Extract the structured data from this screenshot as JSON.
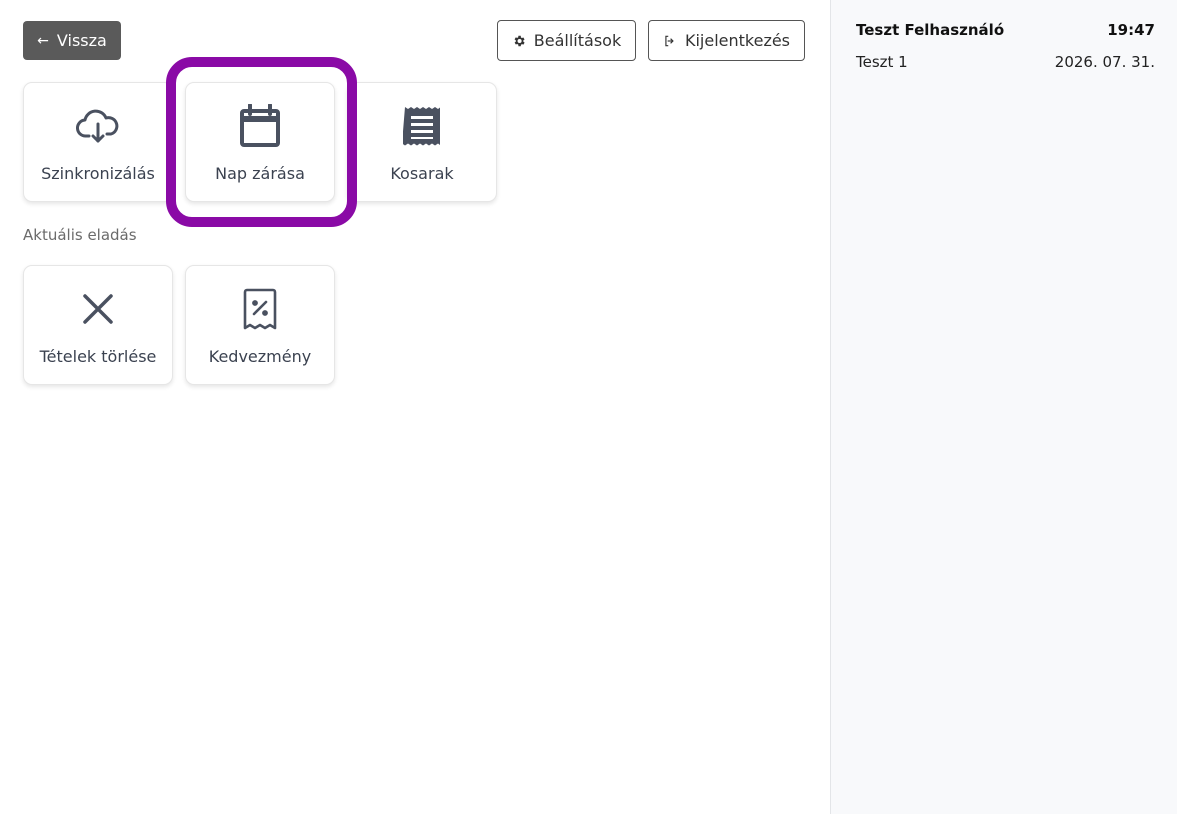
{
  "header": {
    "back_label": "Vissza",
    "settings_label": "Beállítások",
    "logout_label": "Kijelentkezés"
  },
  "tiles": [
    {
      "label": "Szinkronizálás",
      "icon": "cloud-download-icon"
    },
    {
      "label": "Nap zárása",
      "icon": "calendar-icon"
    },
    {
      "label": "Kosarak",
      "icon": "receipt-list-icon"
    }
  ],
  "current_sale": {
    "section_label": "Aktuális eladás",
    "tiles": [
      {
        "label": "Tételek törlése",
        "icon": "close-icon"
      },
      {
        "label": "Kedvezmény",
        "icon": "discount-receipt-icon"
      }
    ]
  },
  "sidebar": {
    "user_name": "Teszt Felhasználó",
    "time": "19:47",
    "terminal": "Teszt 1",
    "date": "2026. 07. 31."
  },
  "colors": {
    "highlight": "#8a0aa6",
    "back_button_bg": "#5a5a5a",
    "icon": "#4a5160"
  }
}
